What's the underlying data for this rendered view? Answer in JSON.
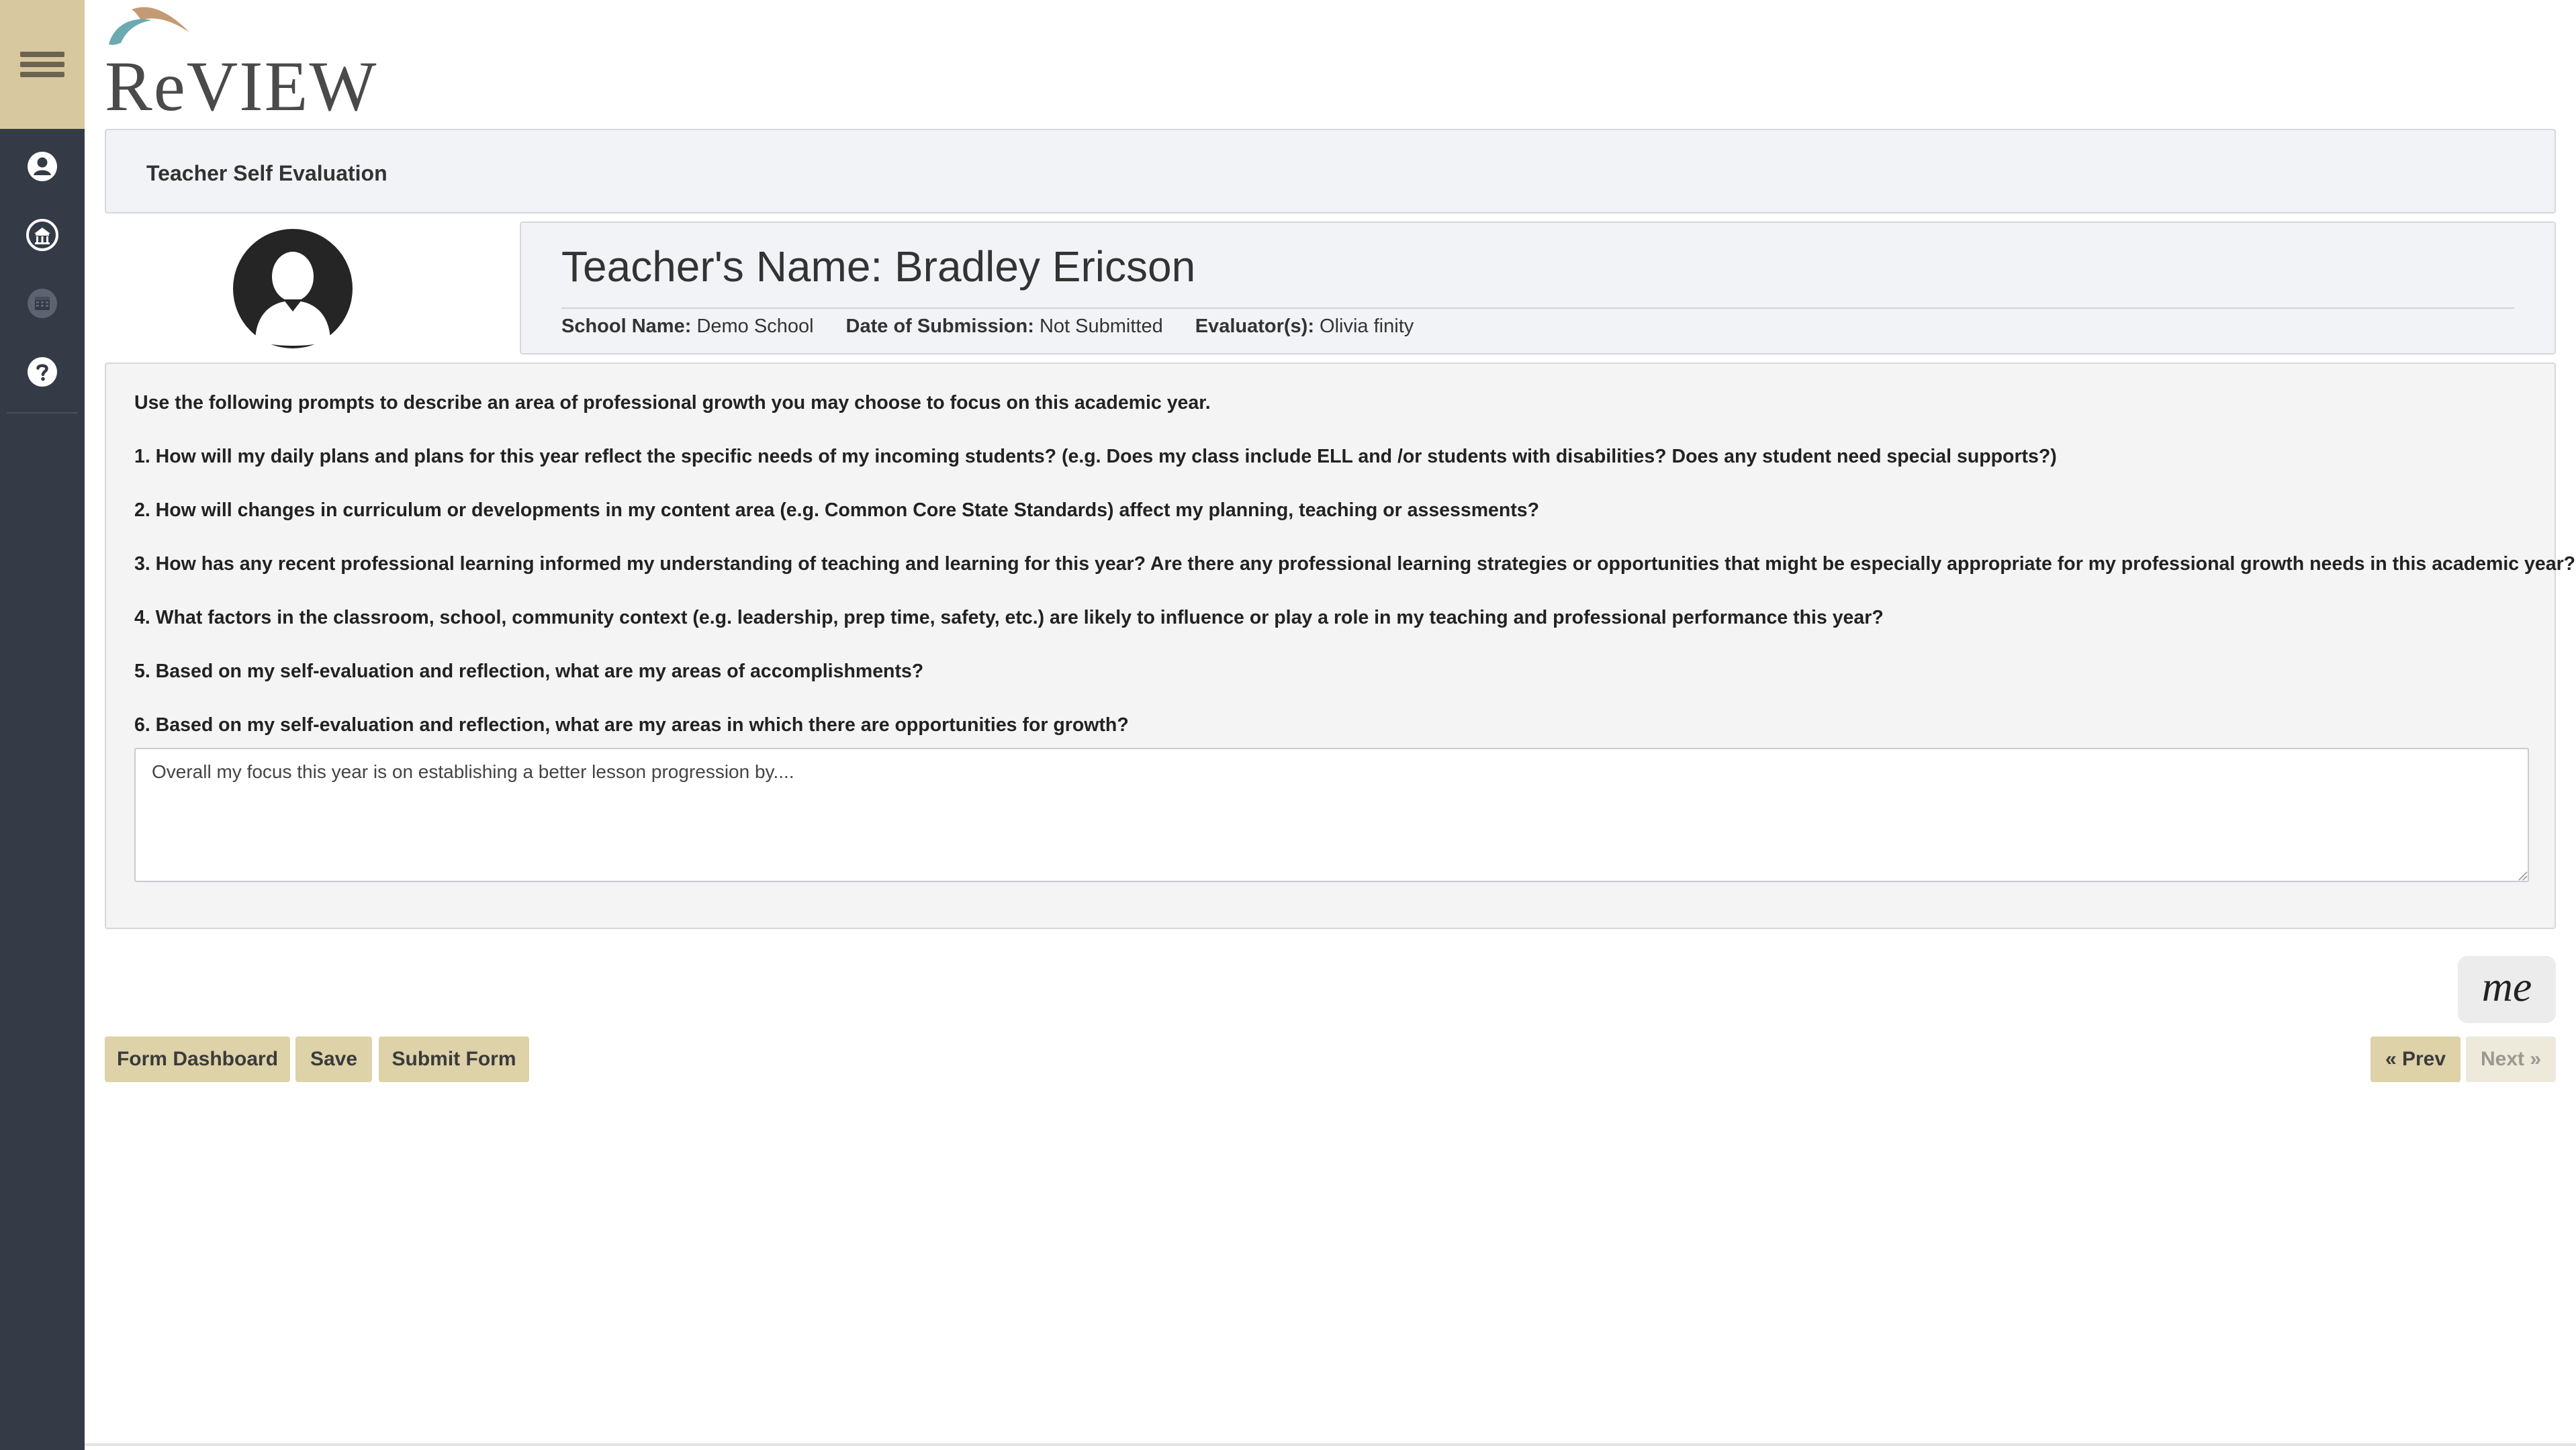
{
  "app": {
    "logo_text": "ReVIEW"
  },
  "header": {
    "title": "Teacher Self Evaluation"
  },
  "teacher": {
    "name_heading": "Teacher's Name: Bradley Ericson",
    "school_label": "School Name:",
    "school_value": "Demo School",
    "submission_label": "Date of Submission:",
    "submission_value": "Not Submitted",
    "evaluator_label": "Evaluator(s):",
    "evaluator_value": "Olivia finity"
  },
  "prompts": {
    "intro": "Use the following prompts to describe an area of professional growth you may choose to focus on this academic year.",
    "items": [
      "1. How will my daily plans and plans for this year reflect the specific needs of my incoming students? (e.g. Does my class include ELL and /or students with disabilities? Does any student need special supports?)",
      "2. How will changes in curriculum or developments in my content area (e.g. Common Core State Standards) affect my planning, teaching or assessments?",
      "3. How has any recent professional learning informed my understanding of teaching and learning for this year? Are there any professional learning strategies or opportunities that might be especially appropriate for my professional growth needs in this academic year?",
      "4. What factors in the classroom, school, community context (e.g. leadership, prep time, safety, etc.) are likely to influence or play a role in my teaching and professional performance this year?",
      "5. Based on my self-evaluation and reflection, what are my areas of accomplishments?",
      "6. Based on my self-evaluation and reflection, what are my areas in which there are opportunities for growth?"
    ],
    "answer_value": "Overall my focus this year is on establishing a better lesson progression by...."
  },
  "signature_badge": {
    "text": "me"
  },
  "buttons": {
    "form_dashboard": "Form Dashboard",
    "save": "Save",
    "submit": "Submit Form",
    "prev": "« Prev",
    "next": "Next »"
  },
  "colors": {
    "sidebar_bg": "#343a46",
    "menu_accent": "#d8c8a0",
    "button_bg": "#ddd2a8"
  }
}
